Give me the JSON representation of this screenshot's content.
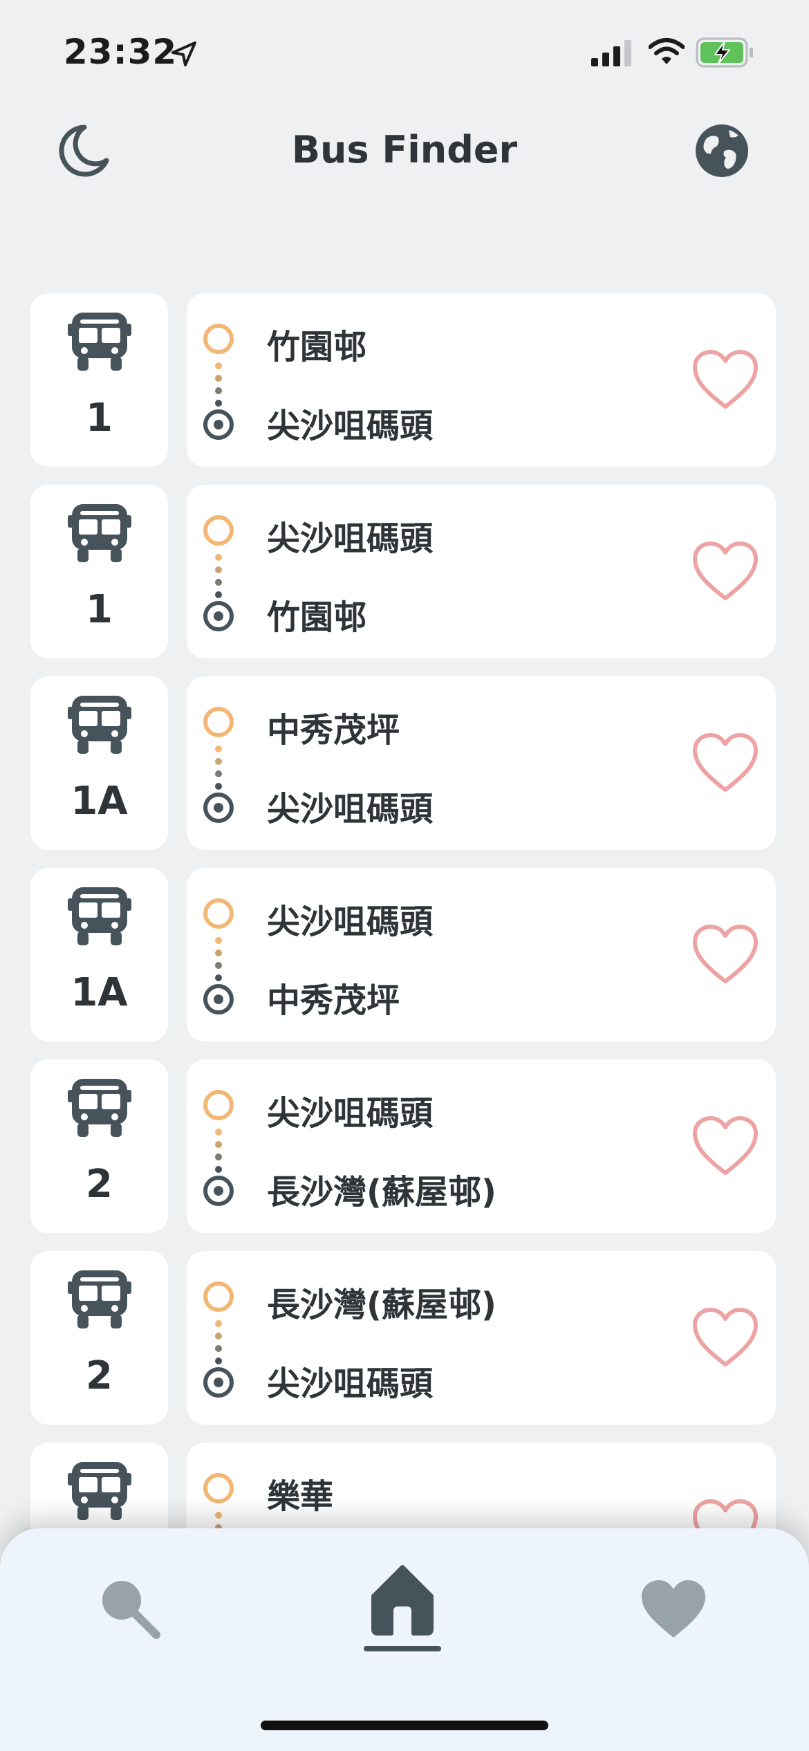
{
  "status_bar": {
    "time": "23:32"
  },
  "header": {
    "title": "Bus Finder"
  },
  "routes": [
    {
      "route": "1",
      "origin": "竹園邨",
      "destination": "尖沙咀碼頭"
    },
    {
      "route": "1",
      "origin": "尖沙咀碼頭",
      "destination": "竹園邨"
    },
    {
      "route": "1A",
      "origin": "中秀茂坪",
      "destination": "尖沙咀碼頭"
    },
    {
      "route": "1A",
      "origin": "尖沙咀碼頭",
      "destination": "中秀茂坪"
    },
    {
      "route": "2",
      "origin": "尖沙咀碼頭",
      "destination": "長沙灣(蘇屋邨)"
    },
    {
      "route": "2",
      "origin": "長沙灣(蘇屋邨)",
      "destination": "尖沙咀碼頭"
    },
    {
      "route": "",
      "origin": "樂華",
      "destination": ""
    }
  ],
  "colors": {
    "origin_marker": "#f2b774",
    "destination_marker": "#47535b",
    "heart": "#eda3a3",
    "nav_inactive": "#97a3a8",
    "nav_active": "#47535b"
  },
  "icons": {
    "header_left": "moon-icon",
    "header_right": "globe-icon",
    "route": "bus-icon",
    "favorite": "heart-outline-icon",
    "nav": [
      "search-icon",
      "home-icon",
      "heart-icon"
    ]
  }
}
